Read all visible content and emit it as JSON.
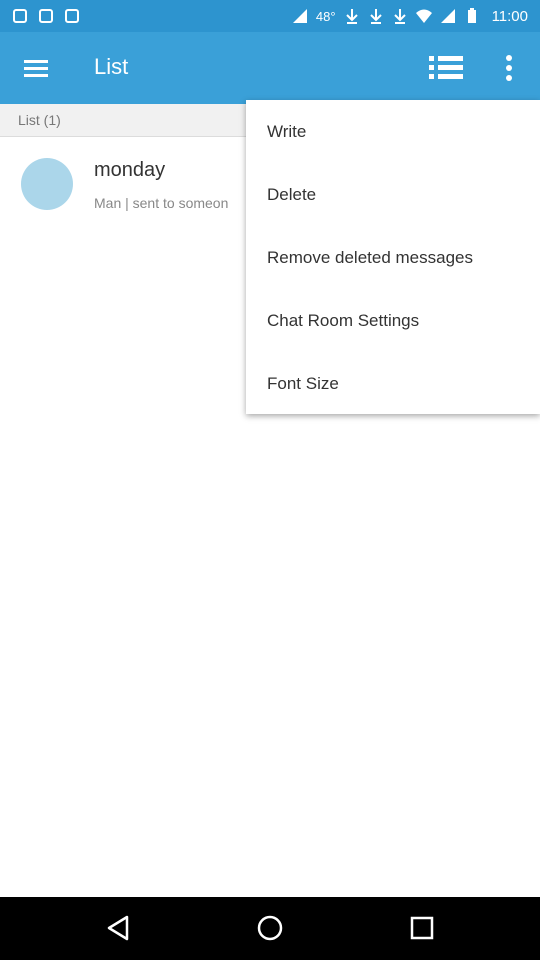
{
  "status_bar": {
    "battery_percent": "48°",
    "time": "11:00"
  },
  "app_bar": {
    "title": "List"
  },
  "list": {
    "header": "List (1)",
    "items": [
      {
        "title": "monday",
        "subtitle": "Man | sent to someon"
      }
    ]
  },
  "menu": {
    "items": [
      {
        "label": "Write"
      },
      {
        "label": "Delete"
      },
      {
        "label": "Remove deleted messages"
      },
      {
        "label": "Chat Room Settings"
      },
      {
        "label": "Font Size"
      }
    ]
  },
  "icons": {
    "app_bar": [
      "hamburger-icon",
      "list-view-icon",
      "overflow-menu-icon"
    ],
    "nav_bar": [
      "back-icon",
      "home-icon",
      "recents-icon"
    ]
  },
  "colors": {
    "status_bar": "#2d94cf",
    "app_bar": "#3aa0d8",
    "avatar": "#abd6ea",
    "nav_bar": "#000000"
  }
}
